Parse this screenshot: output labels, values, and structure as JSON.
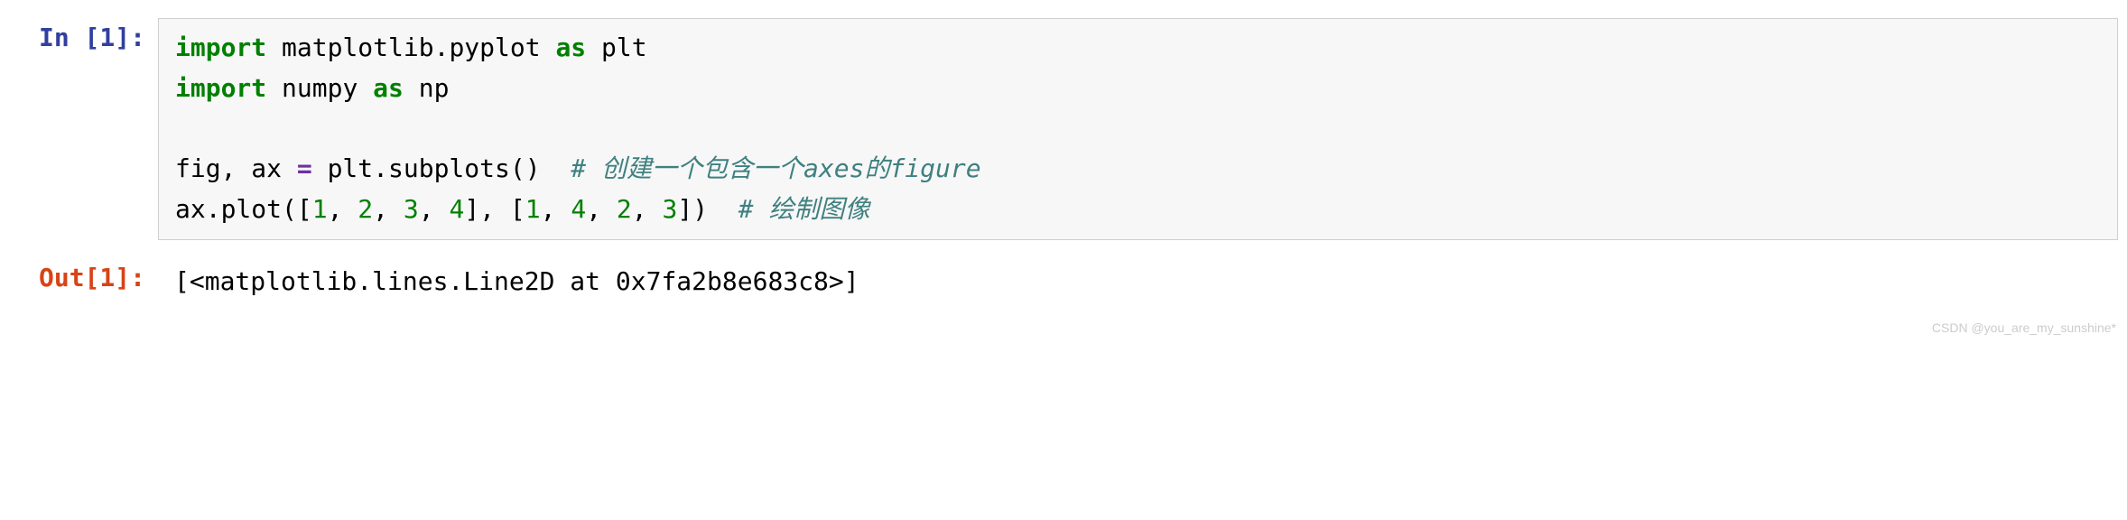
{
  "cells": {
    "input": {
      "prompt": "In [1]:",
      "code": {
        "line1": {
          "import": "import",
          "matplotlib": " matplotlib.pyplot ",
          "as": "as",
          "plt": " plt"
        },
        "line2": {
          "import": "import",
          "numpy": " numpy ",
          "as": "as",
          "np": " np"
        },
        "line4": {
          "pre": "fig, ax ",
          "op": "=",
          "mid": " plt.subplots()  ",
          "comment": "# 创建一个包含一个axes的figure"
        },
        "line5": {
          "pre": "ax.plot([",
          "n1": "1",
          "c1": ", ",
          "n2": "2",
          "c2": ", ",
          "n3": "3",
          "c3": ", ",
          "n4": "4",
          "mid": "], [",
          "n5": "1",
          "c4": ", ",
          "n6": "4",
          "c5": ", ",
          "n7": "2",
          "c6": ", ",
          "n8": "3",
          "post": "])  ",
          "comment": "# 绘制图像"
        }
      }
    },
    "output": {
      "prompt": "Out[1]:",
      "text": "[<matplotlib.lines.Line2D at 0x7fa2b8e683c8>]"
    }
  },
  "watermark": "CSDN @you_are_my_sunshine*"
}
